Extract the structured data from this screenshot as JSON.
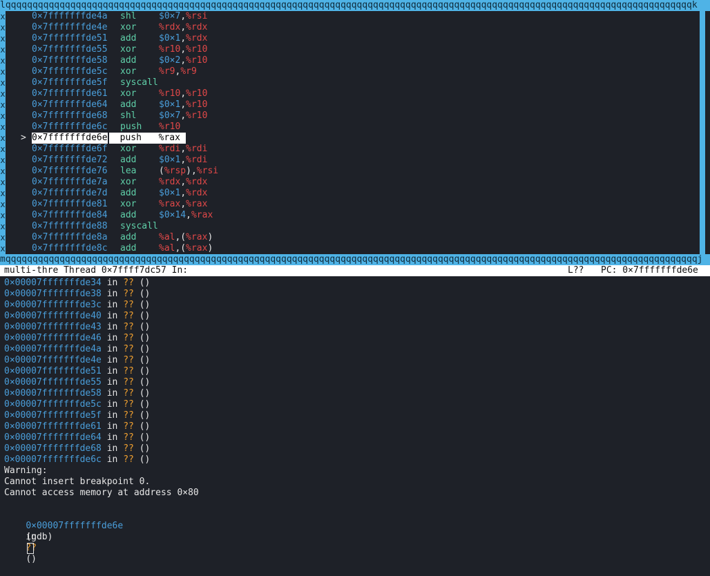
{
  "tui": {
    "top_border": "lqqqqqqqqqqqqqqqqqqqqqqqqqqqqqqqqqqqqqqqqqqqqqqqqqqqqqqqqqqqqqqqqqqqqqqqqqqqqqqqqqqqqqqqqqqqqqqqqqqqqqqqqqqqqqqqqqqqqqqqqqqqqqqqk",
    "bottom_border": "mqqqqqqqqqqqqqqqqqqqqqqqqqqqqqqqqqqqqqqqqqqqqqqqqqqqqqqqqqqqqqqqqqqqqqqqqqqqqqqqqqqqqqqqqqqqqqqqqqqqqqqqqqqqqqqqqqqqqqqqqqqqqqqqqj",
    "side_char": "x",
    "current_marker": ">",
    "asm": [
      {
        "addr": "0×7fffffffde4a",
        "op": "shl",
        "args": [
          {
            "t": "imm",
            "v": "$0×7"
          },
          {
            "t": "pun",
            "v": ","
          },
          {
            "t": "reg",
            "v": "%rsi"
          }
        ]
      },
      {
        "addr": "0×7fffffffde4e",
        "op": "xor",
        "args": [
          {
            "t": "reg",
            "v": "%rdx"
          },
          {
            "t": "pun",
            "v": ","
          },
          {
            "t": "reg",
            "v": "%rdx"
          }
        ]
      },
      {
        "addr": "0×7fffffffde51",
        "op": "add",
        "args": [
          {
            "t": "imm",
            "v": "$0×1"
          },
          {
            "t": "pun",
            "v": ","
          },
          {
            "t": "reg",
            "v": "%rdx"
          }
        ]
      },
      {
        "addr": "0×7fffffffde55",
        "op": "xor",
        "args": [
          {
            "t": "reg",
            "v": "%r10"
          },
          {
            "t": "pun",
            "v": ","
          },
          {
            "t": "reg",
            "v": "%r10"
          }
        ]
      },
      {
        "addr": "0×7fffffffde58",
        "op": "add",
        "args": [
          {
            "t": "imm",
            "v": "$0×2"
          },
          {
            "t": "pun",
            "v": ","
          },
          {
            "t": "reg",
            "v": "%r10"
          }
        ]
      },
      {
        "addr": "0×7fffffffde5c",
        "op": "xor",
        "args": [
          {
            "t": "reg",
            "v": "%r9"
          },
          {
            "t": "pun",
            "v": ","
          },
          {
            "t": "reg",
            "v": "%r9"
          }
        ]
      },
      {
        "addr": "0×7fffffffde5f",
        "op": "syscall",
        "args": []
      },
      {
        "addr": "0×7fffffffde61",
        "op": "xor",
        "args": [
          {
            "t": "reg",
            "v": "%r10"
          },
          {
            "t": "pun",
            "v": ","
          },
          {
            "t": "reg",
            "v": "%r10"
          }
        ]
      },
      {
        "addr": "0×7fffffffde64",
        "op": "add",
        "args": [
          {
            "t": "imm",
            "v": "$0×1"
          },
          {
            "t": "pun",
            "v": ","
          },
          {
            "t": "reg",
            "v": "%r10"
          }
        ]
      },
      {
        "addr": "0×7fffffffde68",
        "op": "shl",
        "args": [
          {
            "t": "imm",
            "v": "$0×7"
          },
          {
            "t": "pun",
            "v": ","
          },
          {
            "t": "reg",
            "v": "%r10"
          }
        ]
      },
      {
        "addr": "0×7fffffffde6c",
        "op": "push",
        "args": [
          {
            "t": "reg",
            "v": "%r10"
          }
        ]
      },
      {
        "addr": "0×7fffffffde6e",
        "op": "push",
        "args": [
          {
            "t": "pun",
            "v": "%rax"
          }
        ],
        "current": true
      },
      {
        "addr": "0×7fffffffde6f",
        "op": "xor",
        "args": [
          {
            "t": "reg",
            "v": "%rdi"
          },
          {
            "t": "pun",
            "v": ","
          },
          {
            "t": "reg",
            "v": "%rdi"
          }
        ]
      },
      {
        "addr": "0×7fffffffde72",
        "op": "add",
        "args": [
          {
            "t": "imm",
            "v": "$0×1"
          },
          {
            "t": "pun",
            "v": ","
          },
          {
            "t": "reg",
            "v": "%rdi"
          }
        ]
      },
      {
        "addr": "0×7fffffffde76",
        "op": "lea",
        "args": [
          {
            "t": "pun",
            "v": "("
          },
          {
            "t": "reg",
            "v": "%rsp"
          },
          {
            "t": "pun",
            "v": "),"
          },
          {
            "t": "reg",
            "v": "%rsi"
          }
        ]
      },
      {
        "addr": "0×7fffffffde7a",
        "op": "xor",
        "args": [
          {
            "t": "reg",
            "v": "%rdx"
          },
          {
            "t": "pun",
            "v": ","
          },
          {
            "t": "reg",
            "v": "%rdx"
          }
        ]
      },
      {
        "addr": "0×7fffffffde7d",
        "op": "add",
        "args": [
          {
            "t": "imm",
            "v": "$0×1"
          },
          {
            "t": "pun",
            "v": ","
          },
          {
            "t": "reg",
            "v": "%rdx"
          }
        ]
      },
      {
        "addr": "0×7fffffffde81",
        "op": "xor",
        "args": [
          {
            "t": "reg",
            "v": "%rax"
          },
          {
            "t": "pun",
            "v": ","
          },
          {
            "t": "reg",
            "v": "%rax"
          }
        ]
      },
      {
        "addr": "0×7fffffffde84",
        "op": "add",
        "args": [
          {
            "t": "imm",
            "v": "$0×14"
          },
          {
            "t": "pun",
            "v": ","
          },
          {
            "t": "reg",
            "v": "%rax"
          }
        ]
      },
      {
        "addr": "0×7fffffffde88",
        "op": "syscall",
        "args": []
      },
      {
        "addr": "0×7fffffffde8a",
        "op": "add",
        "args": [
          {
            "t": "reg",
            "v": "%al"
          },
          {
            "t": "pun",
            "v": ",("
          },
          {
            "t": "reg",
            "v": "%rax"
          },
          {
            "t": "pun",
            "v": ")"
          }
        ]
      },
      {
        "addr": "0×7fffffffde8c",
        "op": "add",
        "args": [
          {
            "t": "reg",
            "v": "%al"
          },
          {
            "t": "pun",
            "v": ",("
          },
          {
            "t": "reg",
            "v": "%rax"
          },
          {
            "t": "pun",
            "v": ")"
          }
        ]
      }
    ]
  },
  "status": {
    "left": "multi-thre Thread 0×7ffff7dc57 In:",
    "line": "L??",
    "pc": "PC: 0×7fffffffde6e"
  },
  "console": {
    "frames": [
      "0×00007fffffffde34",
      "0×00007fffffffde38",
      "0×00007fffffffde3c",
      "0×00007fffffffde40",
      "0×00007fffffffde43",
      "0×00007fffffffde46",
      "0×00007fffffffde4a",
      "0×00007fffffffde4e",
      "0×00007fffffffde51",
      "0×00007fffffffde55",
      "0×00007fffffffde58",
      "0×00007fffffffde5c",
      "0×00007fffffffde5f",
      "0×00007fffffffde61",
      "0×00007fffffffde64",
      "0×00007fffffffde68",
      "0×00007fffffffde6c"
    ],
    "in_word": "in",
    "unknown": "??",
    "parens": "()",
    "warning_lines": [
      "Warning:",
      "Cannot insert breakpoint 0.",
      "Cannot access memory at address 0×80"
    ],
    "last_frame": "0×00007fffffffde6e",
    "prompt": "(gdb)"
  },
  "colors": {
    "background": "#1e2128",
    "border": "#4fb3e6",
    "address": "#4a9eda",
    "opcode": "#5fcfa8",
    "register": "#e04848",
    "unknown": "#f0a030"
  }
}
